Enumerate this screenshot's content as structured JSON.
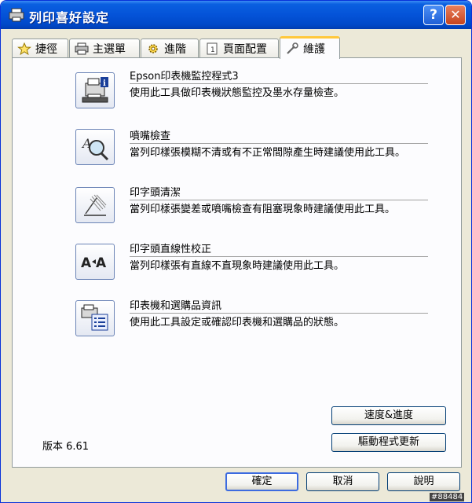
{
  "window": {
    "title": "列印喜好設定",
    "help_label": "?",
    "close_label": "✕"
  },
  "tabs": [
    {
      "label": "捷徑",
      "icon": "star-icon"
    },
    {
      "label": "主選單",
      "icon": "printer-icon"
    },
    {
      "label": "進階",
      "icon": "gear-icon"
    },
    {
      "label": "頁面配置",
      "icon": "page-icon"
    },
    {
      "label": "維護",
      "icon": "wrench-icon",
      "active": true
    }
  ],
  "tools": [
    {
      "title": "Epson印表機監控程式3",
      "desc": "使用此工具做印表機狀態監控及墨水存量檢查。",
      "icon": "printer-monitor-icon"
    },
    {
      "title": "噴嘴檢查",
      "desc": "當列印樣張模糊不清或有不正常間隙產生時建議使用此工具。",
      "icon": "nozzle-check-icon"
    },
    {
      "title": "印字頭清潔",
      "desc": "當列印樣張變差或噴嘴檢查有阻塞現象時建議使用此工具。",
      "icon": "head-cleaning-icon"
    },
    {
      "title": "印字頭直線性校正",
      "desc": "當列印樣張有直線不直現象時建議使用此工具。",
      "icon": "head-alignment-icon"
    },
    {
      "title": "印表機和選購品資訊",
      "desc": "使用此工具設定或確認印表機和選購品的狀態。",
      "icon": "printer-info-icon"
    }
  ],
  "side_buttons": {
    "speed": "速度&進度",
    "driver_update": "驅動程式更新"
  },
  "version": "版本 6.61",
  "footer": {
    "ok": "確定",
    "cancel": "取消",
    "help": "說明"
  },
  "watermark": "#88484"
}
